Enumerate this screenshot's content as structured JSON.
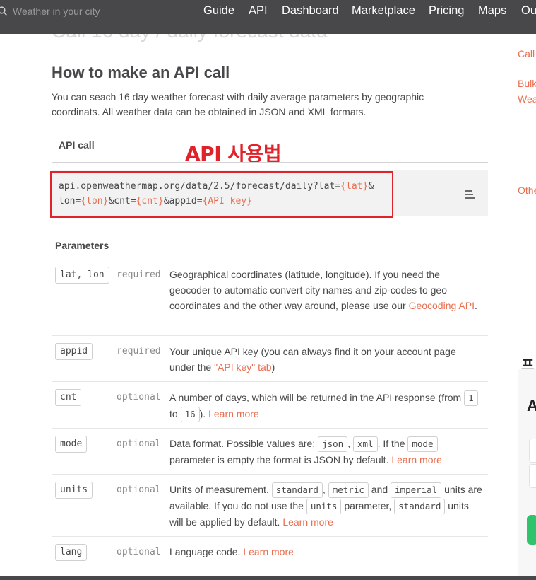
{
  "nav": {
    "search_placeholder": "Weather in your city",
    "items": [
      "Guide",
      "API",
      "Dashboard",
      "Marketplace",
      "Pricing",
      "Maps",
      "Ou"
    ]
  },
  "faded_title": "Call 16 day / daily forecast data",
  "section": {
    "title": "How to make an API call",
    "intro": "You can seach 16 day weather forecast with daily average parameters by geographic coordinats. All weather data can be obtained in JSON and XML formats."
  },
  "api_call": {
    "label": "API call",
    "annotation": "API 사용법",
    "line1_prefix": "api.openweathermap.org/data/2.5/forecast/daily?lat=",
    "line1_var": "{lat}",
    "line1_suffix": "&",
    "line2_a": "lon=",
    "line2_var1": "{lon}",
    "line2_b": "&cnt=",
    "line2_var2": "{cnt}",
    "line2_c": "&appid=",
    "line2_var3": "{API key}"
  },
  "parameters": {
    "label": "Parameters",
    "rows": [
      {
        "name": "lat, lon",
        "req": "required",
        "desc": "Geographical coordinates (latitude, longitude). If you need the geocoder to automatic convert city names and zip-codes to geo coordinates and the other way around, please use our ",
        "link": "Geocoding API",
        "tail": "."
      },
      {
        "name": "appid",
        "req": "required",
        "desc": "Your unique API key (you can always find it on your account page under the ",
        "link": "\"API key\" tab",
        "tail": ")"
      },
      {
        "name": "cnt",
        "req": "optional",
        "desc": "A number of days, which will be returned in the API response (from ",
        "chip1": "1",
        "mid": " to ",
        "chip2": "16",
        "tail": "). ",
        "link": "Learn more"
      },
      {
        "name": "mode",
        "req": "optional",
        "desc": "Data format. Possible values are: ",
        "chip1": "json",
        "sep": ", ",
        "chip2": "xml",
        "mid": ". If the ",
        "chip3": "mode",
        "tail": " parameter is empty the format is JSON by default. ",
        "link": "Learn more"
      },
      {
        "name": "units",
        "req": "optional",
        "desc": "Units of measurement. ",
        "chip1": "standard",
        "sep1": ", ",
        "chip2": "metric",
        "sep2": " and ",
        "chip3": "imperial",
        "mid": " units are available. If you do not use the ",
        "chip4": "units",
        "mid2": " parameter, ",
        "chip5": "standard",
        "tail": " units will be applied by default. ",
        "link": "Learn more"
      },
      {
        "name": "lang",
        "req": "optional",
        "desc": "Language code. ",
        "link": "Learn more"
      }
    ]
  },
  "sidebar": {
    "links": [
      "Call",
      "Bulk",
      "Wea",
      "Othe"
    ],
    "heading": "프",
    "subheading": "A"
  },
  "colors": {
    "nav_bg": "#48484a",
    "accent": "#e96e50",
    "annotation_red": "#e0232a",
    "code_bg": "#f2f2f2"
  }
}
